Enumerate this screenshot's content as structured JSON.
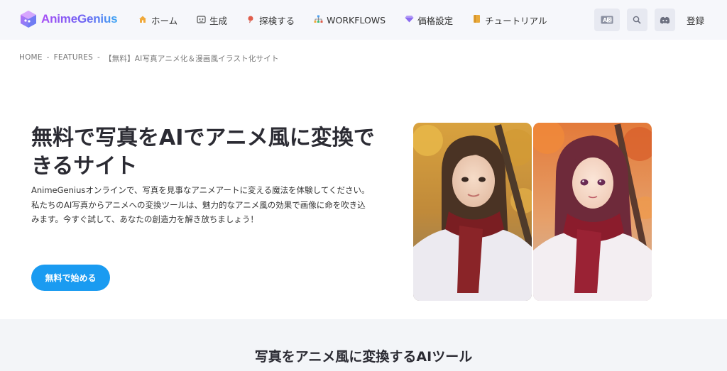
{
  "brand": {
    "name": "AnimeGenius"
  },
  "nav": {
    "items": [
      {
        "label": "ホーム",
        "icon": "home-icon"
      },
      {
        "label": "生成",
        "icon": "generate-icon"
      },
      {
        "label": "探検する",
        "icon": "explore-icon"
      },
      {
        "label": "WORKFLOWS",
        "icon": "workflows-icon"
      },
      {
        "label": "価格設定",
        "icon": "diamond-icon"
      },
      {
        "label": "チュートリアル",
        "icon": "book-icon"
      }
    ],
    "signup_label": "登録"
  },
  "header_icons": [
    "translate-icon",
    "search-icon",
    "discord-icon"
  ],
  "breadcrumb": {
    "home": "HOME",
    "features": "FEATURES",
    "current": "【無料】AI写真アニメ化＆漫画風イラスト化サイト",
    "separator": "-"
  },
  "hero": {
    "title": "無料で写真をAIでアニメ風に変換できるサイト",
    "description": "AnimeGeniusオンラインで、写真を見事なアニメアートに変える魔法を体験してください。私たちのAI写真からアニメへの変換ツールは、魅力的なアニメ風の効果で画像に命を吹き込みます。今すぐ試して、あなたの創造力を解き放ちましょう！",
    "cta_label": "無料で始める"
  },
  "tools_section": {
    "title": "写真をアニメ風に変換するAIツール"
  },
  "colors": {
    "accent": "#1a9bf1",
    "header_bg": "#f6f7fb",
    "section_bg": "#f3f5f8"
  }
}
